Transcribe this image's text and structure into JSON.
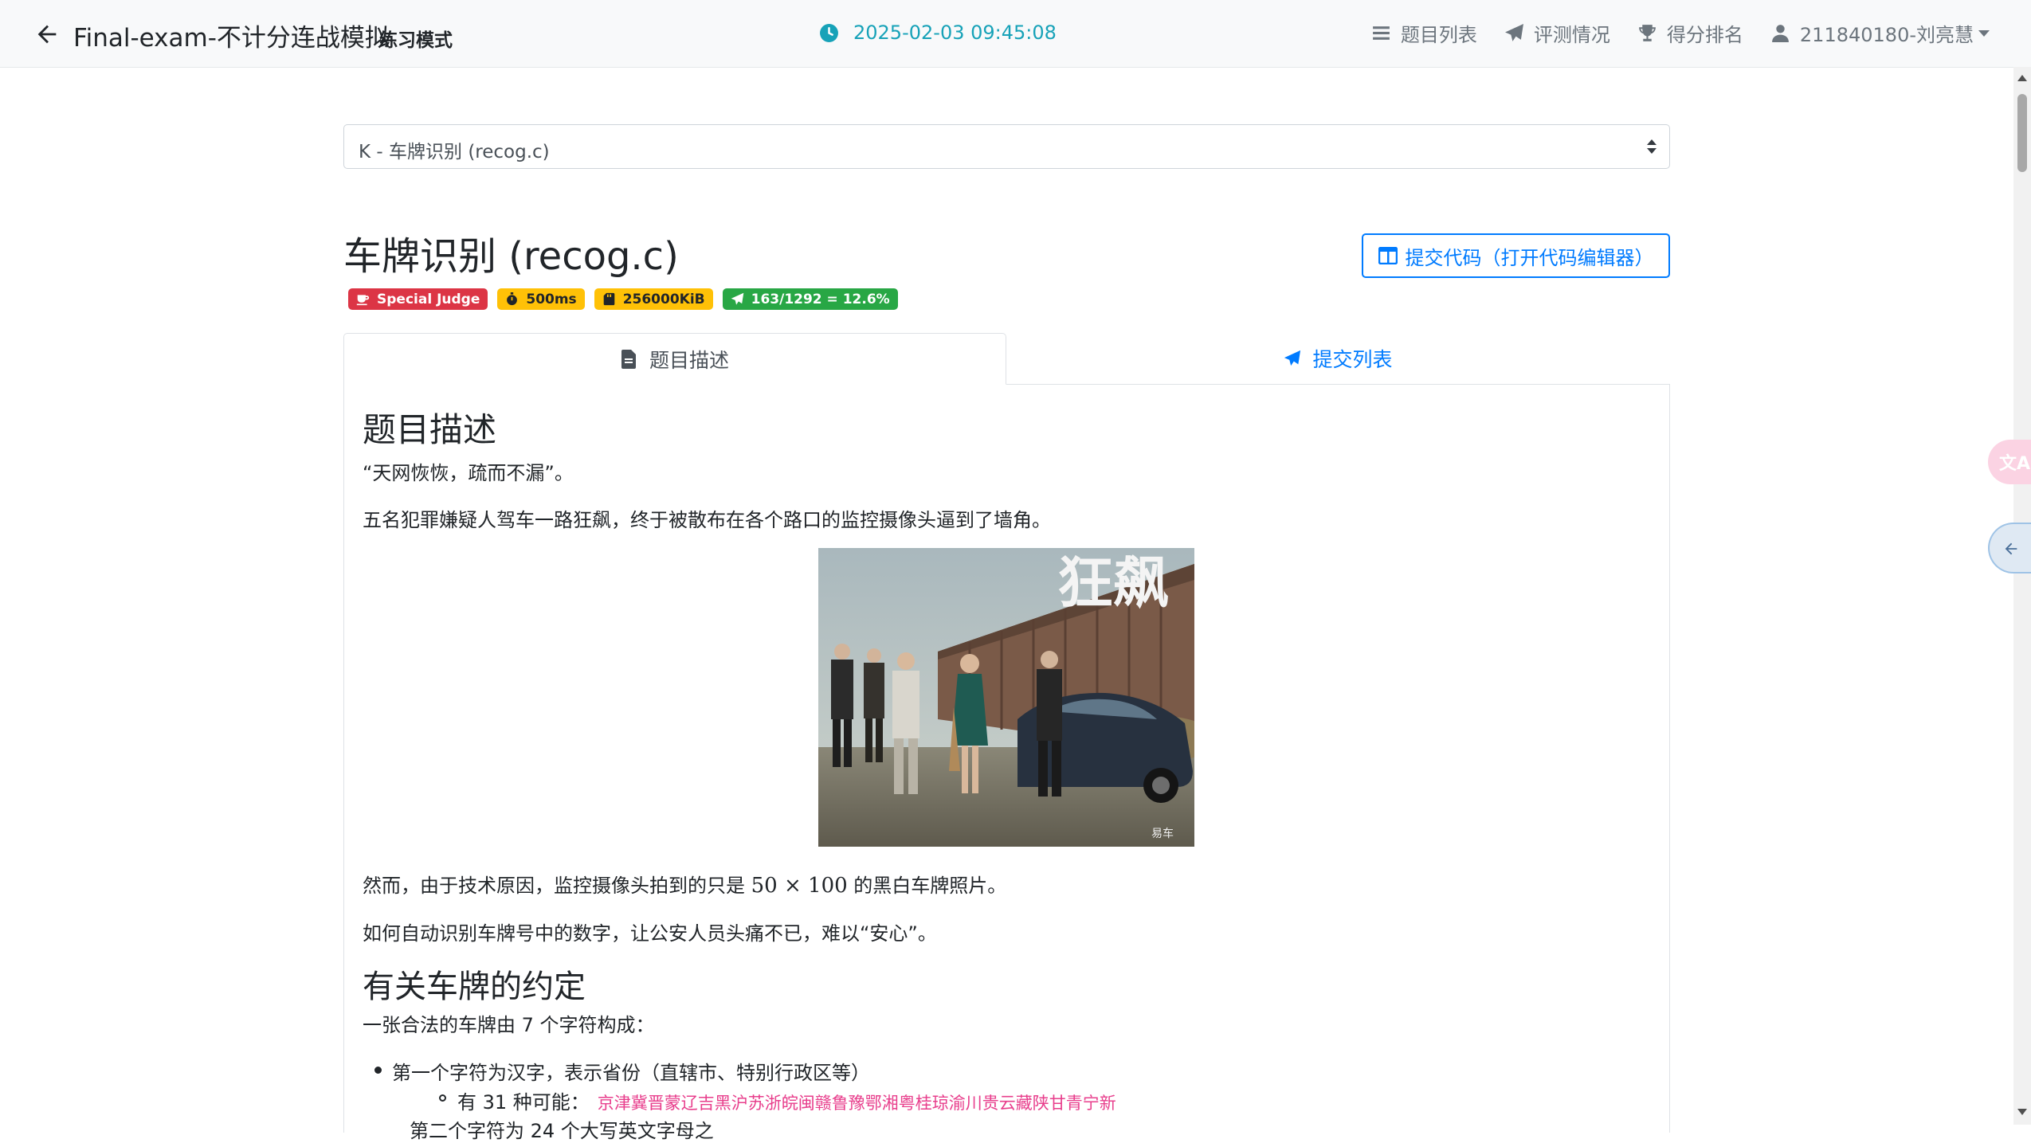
{
  "header": {
    "title": "Final-exam-不计分连战模拟",
    "mode": "练习模式",
    "datetime": "2025-02-03 09:45:08",
    "nav": {
      "problems": "题目列表",
      "status": "评测情况",
      "ranking": "得分排名",
      "user": "211840180-刘亮慧"
    }
  },
  "selector": {
    "value": "K - 车牌识别 (recog.c)"
  },
  "problem": {
    "title": "车牌识别 (recog.c)",
    "submit_label": "提交代码（打开代码编辑器）",
    "badges": {
      "judge": "Special Judge",
      "time": "500ms",
      "memory": "256000KiB",
      "accept": "163/1292 = 12.6%"
    }
  },
  "tabs": {
    "description": "题目描述",
    "submissions": "提交列表"
  },
  "content": {
    "h_desc": "题目描述",
    "p1": "“天网恢恢，疏而不漏”。",
    "p2": "五名犯罪嫌疑人驾车一路狂飙，终于被散布在各个路口的监控摄像头逼到了墙角。",
    "image_text": "狂飙",
    "image_watermark": "易车",
    "p3_pre": "然而，由于技术原因，监控摄像头拍到的只是 ",
    "p3_math": "50 × 100",
    "p3_post": " 的黑白车牌照片。",
    "p4": "如何自动识别车牌号中的数字，让公安人员头痛不已，难以“安心”。",
    "h_plate": "有关车牌的约定",
    "p5": "一张合法的车牌由 7 个字符构成：",
    "li1": "第一个字符为汉字，表示省份（直辖市、特别行政区等）",
    "li2_label": "有 31 种可能：",
    "li2_chars": "京津冀晋蒙辽吉黑沪苏浙皖闽赣鲁豫鄂湘粤桂琼渝川贵云藏陕甘青宁新",
    "li3": "第二个字符为 24 个大写英文字母之"
  },
  "colors": {
    "accent": "#007bff",
    "clock": "#17a2b8",
    "danger": "#dc3545",
    "warning": "#ffc107",
    "success": "#28a745",
    "code_pink": "#e83e8c"
  },
  "icons": {
    "back": "arrow-left-icon",
    "clock": "clock-icon",
    "list": "list-icon",
    "status": "paper-plane-icon",
    "ranking": "trophy-icon",
    "user": "user-icon"
  }
}
